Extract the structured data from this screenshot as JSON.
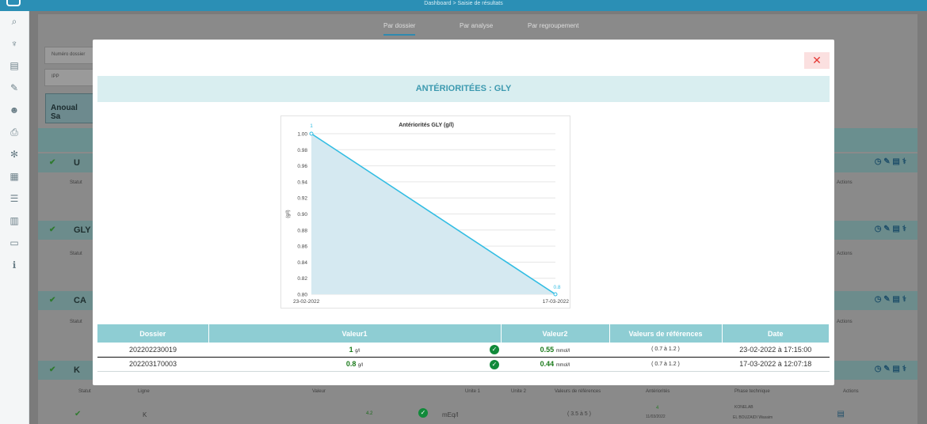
{
  "topbar": {
    "breadcrumb": "Dashboard > Saisie de résultats"
  },
  "sidebar": {
    "icons": [
      "search-icon",
      "stethoscope-icon",
      "report-icon",
      "edit-icon",
      "user-icon",
      "print-icon",
      "gear-icon",
      "calculator-icon",
      "list-icon",
      "bar-chart-icon",
      "laptop-icon",
      "info-icon"
    ]
  },
  "background": {
    "tabs": [
      "Par dossier",
      "Par analyse",
      "Par regroupement"
    ],
    "fields": {
      "dossier_label": "Numéro dossier",
      "ipp_label": "IPP"
    },
    "patient_name": "Anoual Sa",
    "sections": [
      "U",
      "GLY",
      "CA",
      "K"
    ],
    "columns": {
      "statut": "Statut",
      "ligne": "Ligne",
      "valeur": "Valeur",
      "unite1": "Unite 1",
      "unite2": "Unite 2",
      "refs": "Valeurs de références",
      "anter": "Antériorités",
      "phase": "Phase technique",
      "actions": "Actions"
    },
    "k_row": {
      "ligne": "K",
      "valeur": "4.2",
      "unite": "mEq/l",
      "refs": "( 3.5 à 5 )",
      "anter_value": "4",
      "anter_date": "11/03/2022",
      "phase1": "KONELAB",
      "phase2": "EL BOUZAIDI Wasaim"
    }
  },
  "modal": {
    "close_label": "✕",
    "title": "ANTÉRIORITÉES : GLY",
    "table": {
      "headers": [
        "Dossier",
        "Valeur1",
        "Valeur2",
        "Valeurs de références",
        "Date"
      ],
      "rows": [
        {
          "dossier": "202202230019",
          "valeur1": "1",
          "unit1": "g/l",
          "valeur2": "0.55",
          "unit2": "mmol/l",
          "refs": "( 0.7 à 1.2 )",
          "date": "23-02-2022 à 17:15:00"
        },
        {
          "dossier": "202203170003",
          "valeur1": "0.8",
          "unit1": "g/l",
          "valeur2": "0.44",
          "unit2": "mmol/l",
          "refs": "( 0.7 à 1.2 )",
          "date": "17-03-2022 à 12:07:18"
        }
      ]
    }
  },
  "chart_data": {
    "type": "area",
    "title": "Antériorités GLY (g/l)",
    "ylabel": "(g/l)",
    "x": [
      "23-02-2022",
      "17-03-2022"
    ],
    "series": [
      {
        "values": [
          1,
          0.8
        ],
        "data_labels": [
          "1",
          "0.8"
        ]
      }
    ],
    "ylim": [
      0.8,
      1.0
    ],
    "yticks": [
      "1.00",
      "0.98",
      "0.96",
      "0.94",
      "0.92",
      "0.90",
      "0.88",
      "0.86",
      "0.84",
      "0.82",
      "0.80"
    ],
    "grid": true,
    "line_color": "#32bde3",
    "fill_color": "#d5e9f1"
  }
}
